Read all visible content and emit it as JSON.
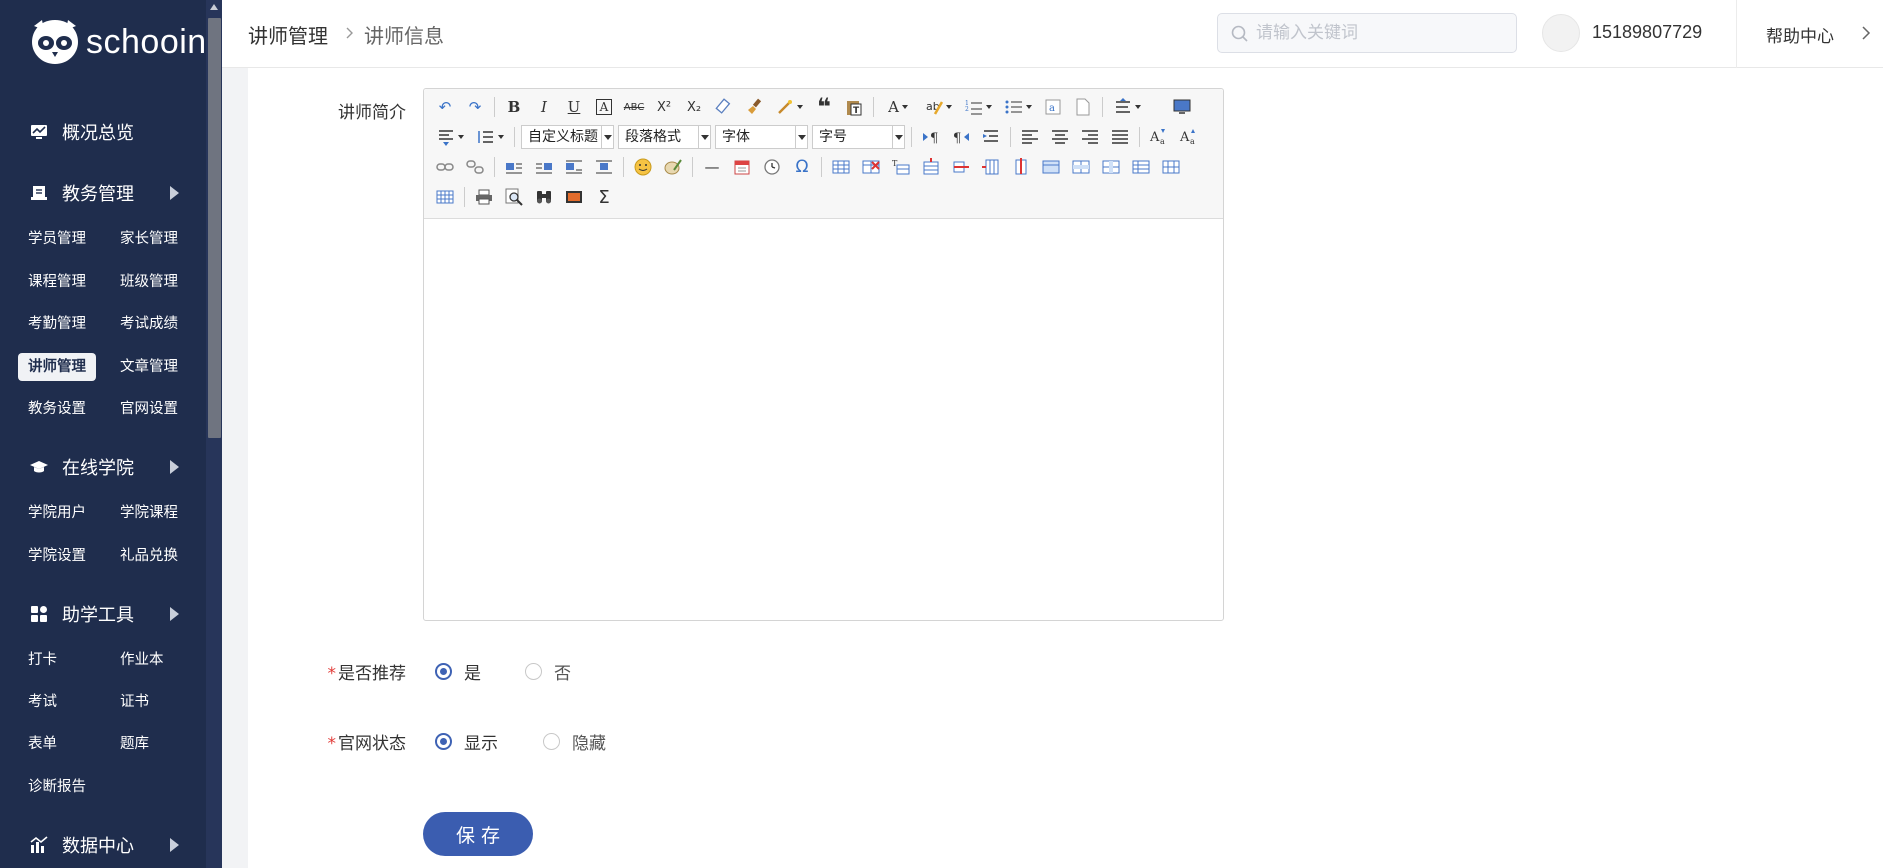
{
  "sidebar": {
    "brand": "schooin",
    "sections": [
      {
        "title": "概况总览",
        "icon": "monitor-icon"
      },
      {
        "title": "教务管理",
        "icon": "book-icon"
      },
      {
        "title": "在线学院",
        "icon": "graduation-cap-icon"
      },
      {
        "title": "助学工具",
        "icon": "grid-icon"
      },
      {
        "title": "数据中心",
        "icon": "chart-icon"
      }
    ],
    "edu_items": [
      "学员管理",
      "家长管理",
      "课程管理",
      "班级管理",
      "考勤管理",
      "考试成绩",
      "讲师管理",
      "文章管理",
      "教务设置",
      "官网设置"
    ],
    "online_items": [
      "学院用户",
      "学院课程",
      "学院设置",
      "礼品兑换"
    ],
    "tool_items": [
      "打卡",
      "作业本",
      "考试",
      "证书",
      "表单",
      "题库",
      "诊断报告"
    ],
    "active_item": "讲师管理"
  },
  "header": {
    "breadcrumb": [
      "讲师管理",
      "讲师信息"
    ],
    "search_placeholder": "请输入关键词",
    "phone": "15189807729",
    "help": "帮助中心"
  },
  "form": {
    "intro_label": "讲师简介",
    "editor": {
      "select_custom_title": "自定义标题",
      "select_paragraph": "段落格式",
      "select_font": "字体",
      "select_size": "字号",
      "icons": {
        "undo": "↶",
        "redo": "↷",
        "bold": "B",
        "italic": "I",
        "underline": "U",
        "fontborder": "A",
        "strike": "ABC",
        "sup": "X²",
        "sub": "X₂",
        "blockquote": "❝",
        "fontcolor": "A",
        "omega": "Ω",
        "sigma": "Σ",
        "hr": "—"
      }
    },
    "recommend_label": "是否推荐",
    "recommend_yes": "是",
    "recommend_no": "否",
    "site_label": "官网状态",
    "site_show": "显示",
    "site_hide": "隐藏",
    "save": "保存"
  },
  "colors": {
    "sidebar_bg": "#1f2d4d",
    "accent": "#3b5db0",
    "required": "#e23c39"
  }
}
